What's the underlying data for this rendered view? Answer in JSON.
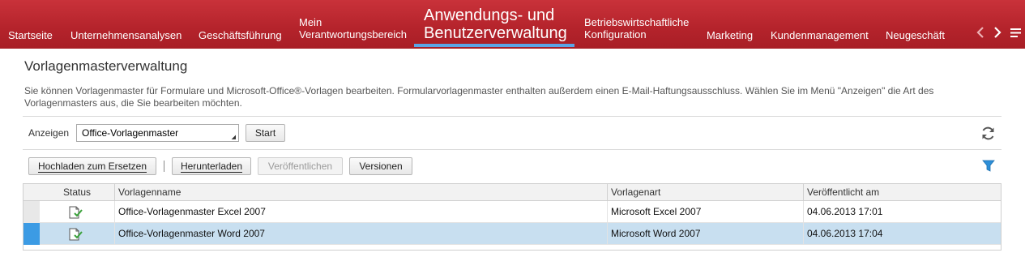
{
  "nav": {
    "items": [
      {
        "label": "Startseite"
      },
      {
        "label": "Unternehmensanalysen"
      },
      {
        "label": "Geschäftsführung"
      },
      {
        "label": "Mein",
        "label2": "Verantwortungsbereich"
      },
      {
        "label": "Anwendungs- und",
        "label2": "Benutzerverwaltung"
      },
      {
        "label": "Betriebswirtschaftliche",
        "label2": "Konfiguration"
      },
      {
        "label": "Marketing"
      },
      {
        "label": "Kundenmanagement"
      },
      {
        "label": "Neugeschäft"
      }
    ],
    "prev_icon": "‹",
    "next_icon": "›",
    "menu_icon": "≡"
  },
  "page": {
    "title": "Vorlagenmasterverwaltung",
    "description": "Sie können Vorlagenmaster für Formulare und Microsoft-Office®-Vorlagen bearbeiten. Formularvorlagenmaster enthalten außerdem einen E-Mail-Haftungsausschluss. Wählen Sie im Menü \"Anzeigen\" die Art des Vorlagenmasters aus, die Sie bearbeiten möchten."
  },
  "filter": {
    "label": "Anzeigen",
    "selected": "Office-Vorlagenmaster",
    "start_label": "Start"
  },
  "toolbar": {
    "upload_label": "Hochladen zum Ersetzen",
    "download_label": "Herunterladen",
    "publish_label": "Veröffentlichen",
    "versions_label": "Versionen"
  },
  "table": {
    "columns": [
      "Status",
      "Vorlagenname",
      "Vorlagenart",
      "Veröffentlicht am"
    ],
    "rows": [
      {
        "name": "Office-Vorlagenmaster Excel 2007",
        "type": "Microsoft Excel 2007",
        "published": "04.06.2013 17:01",
        "selected": false
      },
      {
        "name": "Office-Vorlagenmaster Word 2007",
        "type": "Microsoft Word 2007",
        "published": "04.06.2013 17:04",
        "selected": true
      }
    ]
  },
  "colors": {
    "nav_bg": "#b4232b",
    "active_indicator": "#5aa5e6",
    "selected_row": "#c8dff0",
    "row_selector_active": "#3c9be4"
  }
}
